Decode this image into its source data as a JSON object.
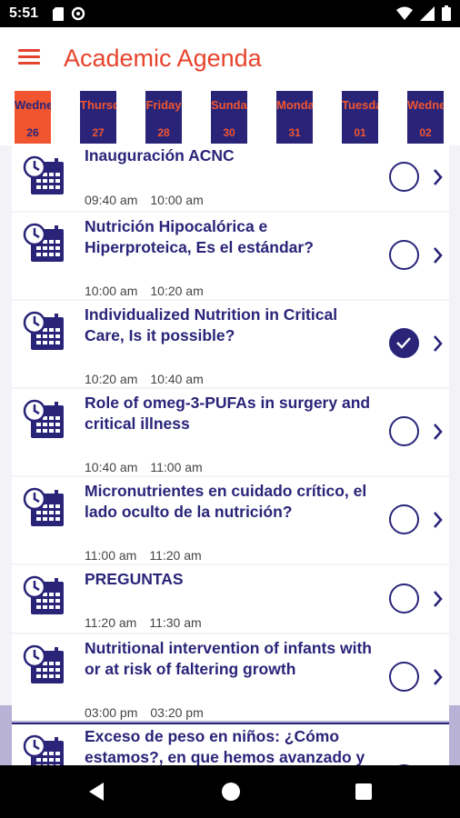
{
  "status_bar": {
    "time": "5:51",
    "left_icons": [
      "sd-card-icon",
      "data-saver-icon"
    ],
    "right_icons": [
      "wifi-icon",
      "signal-icon",
      "battery-icon"
    ]
  },
  "header": {
    "menu_icon": "hamburger-menu-icon",
    "title": "Academic Agenda",
    "accent_color": "#e8432c"
  },
  "days": [
    {
      "name": "Wednesday",
      "num": "26",
      "active": true
    },
    {
      "name": "Thursday",
      "num": "27",
      "active": false
    },
    {
      "name": "Friday",
      "num": "28",
      "active": false
    },
    {
      "name": "Sunday",
      "num": "30",
      "active": false
    },
    {
      "name": "Monday",
      "num": "31",
      "active": false
    },
    {
      "name": "Tuesday",
      "num": "01",
      "active": false
    },
    {
      "name": "Wednesday",
      "num": "02",
      "active": false
    }
  ],
  "events": [
    {
      "title": "Inauguración ACNC",
      "start": "09:40 am",
      "end": "10:00 am",
      "checked": false
    },
    {
      "title": "Nutrición Hipocalórica e Hiperproteica, Es el estándar?",
      "start": "10:00 am",
      "end": "10:20 am",
      "checked": false
    },
    {
      "title": "Individualized Nutrition in Critical Care, Is it possible?",
      "start": "10:20 am",
      "end": "10:40 am",
      "checked": true
    },
    {
      "title": "Role of omeg-3-PUFAs in surgery and critical illness",
      "start": "10:40 am",
      "end": "11:00 am",
      "checked": false
    },
    {
      "title": "Micronutrientes en cuidado crítico, el lado oculto de la nutrición?",
      "start": "11:00 am",
      "end": "11:20 am",
      "checked": false
    },
    {
      "title": "PREGUNTAS",
      "start": "11:20 am",
      "end": "11:30 am",
      "checked": false
    },
    {
      "title": "Nutritional intervention of infants with or at risk of faltering growth",
      "start": "03:00 pm",
      "end": "03:20 pm",
      "checked": false
    },
    {
      "title": "Exceso de peso en niños: ¿Cómo estamos?, en que hemos avanzado y",
      "start": "",
      "end": "",
      "checked": false
    }
  ],
  "colors": {
    "primary": "#2a2479",
    "accent": "#f0552f"
  },
  "nav": {
    "back_icon": "back-triangle-icon",
    "home_icon": "home-circle-icon",
    "recents_icon": "recents-square-icon"
  }
}
